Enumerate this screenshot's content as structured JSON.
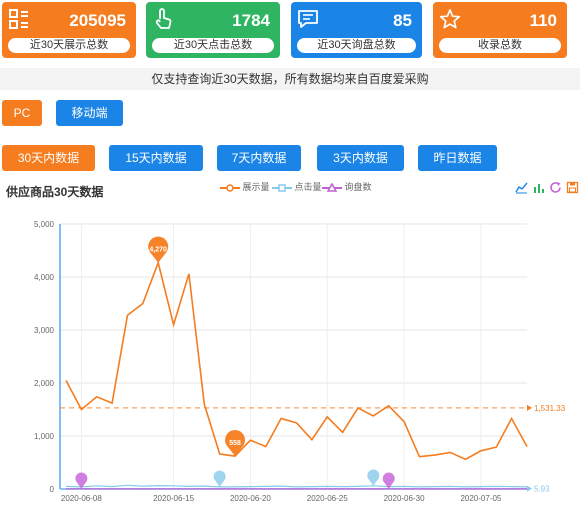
{
  "stat_cards": [
    {
      "value": "205095",
      "label": "近30天展示总数",
      "color": "#f57c1f",
      "icon": "grid-icon"
    },
    {
      "value": "1784",
      "label": "近30天点击总数",
      "color": "#2fb561",
      "icon": "pointer-hand-icon"
    },
    {
      "value": "85",
      "label": "近30天询盘总数",
      "color": "#1a85e6",
      "icon": "chat-bubble-icon"
    },
    {
      "value": "110",
      "label": "收录总数",
      "color": "#f57c1f",
      "icon": "star-icon"
    }
  ],
  "notice": "仅支持查询近30天数据，所有数据均来自百度爱采购",
  "device_tabs": [
    {
      "label": "PC",
      "active": true
    },
    {
      "label": "移动端",
      "active": false
    }
  ],
  "range_tabs": [
    {
      "label": "30天内数据",
      "active": true
    },
    {
      "label": "15天内数据",
      "active": false
    },
    {
      "label": "7天内数据",
      "active": false
    },
    {
      "label": "3天内数据",
      "active": false
    },
    {
      "label": "昨日数据",
      "active": false
    }
  ],
  "chart_title": "供应商品30天数据",
  "toolbox_icons": [
    "line-chart-icon",
    "bar-chart-icon",
    "refresh-icon",
    "save-image-icon"
  ],
  "colors": {
    "orange": "#f57c1f",
    "green": "#2fb561",
    "blue": "#1a85e6",
    "light_blue": "#87c9ee",
    "purple": "#c45fd8"
  },
  "chart_data": {
    "type": "line",
    "ylim": [
      0,
      5000
    ],
    "yticks": [
      "0",
      "1,000",
      "2,000",
      "3,000",
      "4,000",
      "5,000"
    ],
    "xtick_labels": [
      "2020-06-08",
      "2020-06-15",
      "2020-06-20",
      "2020-06-25",
      "2020-06-30",
      "2020-07-05"
    ],
    "grid": true,
    "series": [
      {
        "name": "展示量",
        "color": "#f57c1f",
        "values": [
          2050,
          1500,
          1740,
          1620,
          3280,
          3500,
          4270,
          3100,
          4060,
          1600,
          660,
          620,
          920,
          800,
          1330,
          1250,
          930,
          1360,
          1070,
          1530,
          1380,
          1570,
          1270,
          610,
          640,
          690,
          560,
          720,
          790,
          1330,
          800
        ]
      },
      {
        "name": "点击量",
        "color": "#87c9ee",
        "values": [
          50,
          40,
          60,
          45,
          70,
          55,
          65,
          60,
          50,
          55,
          40,
          40,
          45,
          50,
          55,
          40,
          45,
          50,
          45,
          50,
          60,
          45,
          50,
          40,
          45,
          50,
          40,
          45,
          50,
          45,
          40
        ]
      },
      {
        "name": "询盘数",
        "color": "#c45fd8",
        "values": [
          3,
          5,
          2,
          4,
          3,
          2,
          4,
          3,
          2,
          3,
          2,
          1,
          3,
          2,
          4,
          2,
          3,
          2,
          1,
          3,
          2,
          3,
          2,
          1,
          2,
          3,
          2,
          1,
          2,
          3,
          1
        ]
      }
    ],
    "markpoints": [
      {
        "series": "展示量",
        "label": "4,270",
        "index": 6
      },
      {
        "series": "展示量",
        "label": "558",
        "index": 11
      },
      {
        "series": "点击量",
        "label": "",
        "index": 10
      },
      {
        "series": "点击量",
        "label": "",
        "index": 20
      },
      {
        "series": "询盘数",
        "label": "",
        "index": 1
      },
      {
        "series": "询盘数",
        "label": "",
        "index": 21
      }
    ],
    "average_lines": [
      {
        "series": "展示量",
        "value": 1531.33,
        "label": "1,531.33"
      },
      {
        "series": "点击量",
        "value": 5.93,
        "label": "5.93"
      }
    ]
  }
}
